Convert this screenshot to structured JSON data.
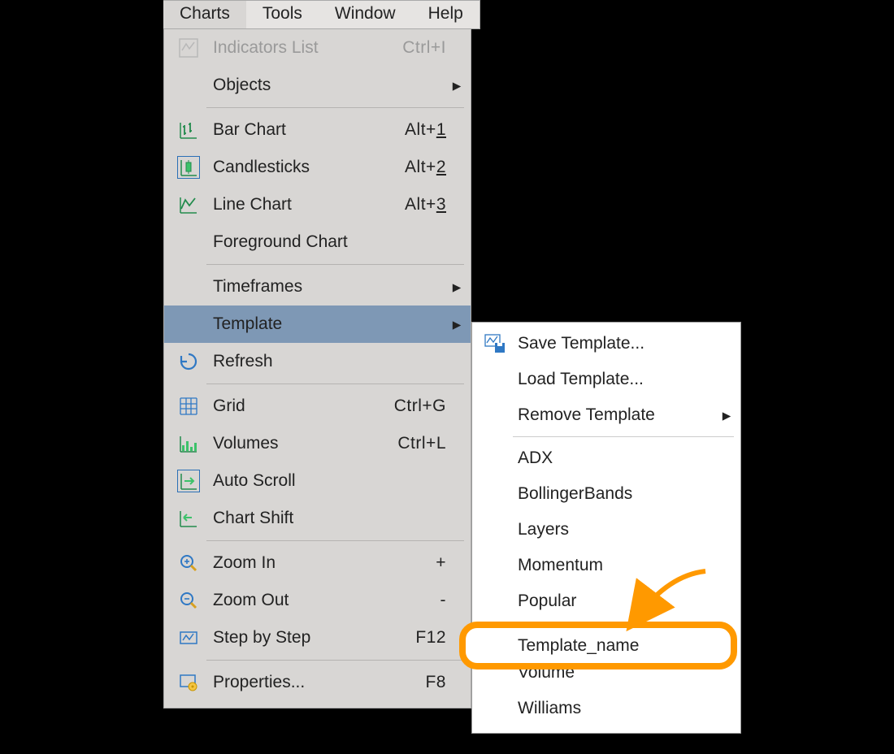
{
  "menubar": {
    "items": [
      "Charts",
      "Tools",
      "Window",
      "Help"
    ],
    "active_index": 0
  },
  "menu": {
    "indicators": {
      "label": "Indicators List",
      "shortcut": "Ctrl+I"
    },
    "objects": {
      "label": "Objects"
    },
    "bar_chart": {
      "label": "Bar Chart",
      "shortcut_prefix": "Alt+",
      "shortcut_key": "1"
    },
    "candlesticks": {
      "label": "Candlesticks",
      "shortcut_prefix": "Alt+",
      "shortcut_key": "2"
    },
    "line_chart": {
      "label": "Line Chart",
      "shortcut_prefix": "Alt+",
      "shortcut_key": "3"
    },
    "foreground": {
      "label": "Foreground Chart"
    },
    "timeframes": {
      "label": "Timeframes"
    },
    "template": {
      "label": "Template"
    },
    "refresh": {
      "label": "Refresh"
    },
    "grid": {
      "label": "Grid",
      "shortcut": "Ctrl+G"
    },
    "volumes": {
      "label": "Volumes",
      "shortcut": "Ctrl+L"
    },
    "auto_scroll": {
      "label": "Auto Scroll"
    },
    "chart_shift": {
      "label": "Chart Shift"
    },
    "zoom_in": {
      "label": "Zoom In",
      "shortcut": "+"
    },
    "zoom_out": {
      "label": "Zoom Out",
      "shortcut": "-"
    },
    "step_by_step": {
      "label": "Step by Step",
      "shortcut": "F12"
    },
    "properties": {
      "label": "Properties...",
      "shortcut": "F8"
    }
  },
  "submenu": {
    "save": {
      "label": "Save Template..."
    },
    "load": {
      "label": "Load Template..."
    },
    "remove": {
      "label": "Remove Template"
    },
    "templates": [
      "ADX",
      "BollingerBands",
      "Layers",
      "Momentum",
      "Popular",
      "Template_name",
      "Volume",
      "Williams"
    ]
  },
  "highlight_label": "Template_name"
}
